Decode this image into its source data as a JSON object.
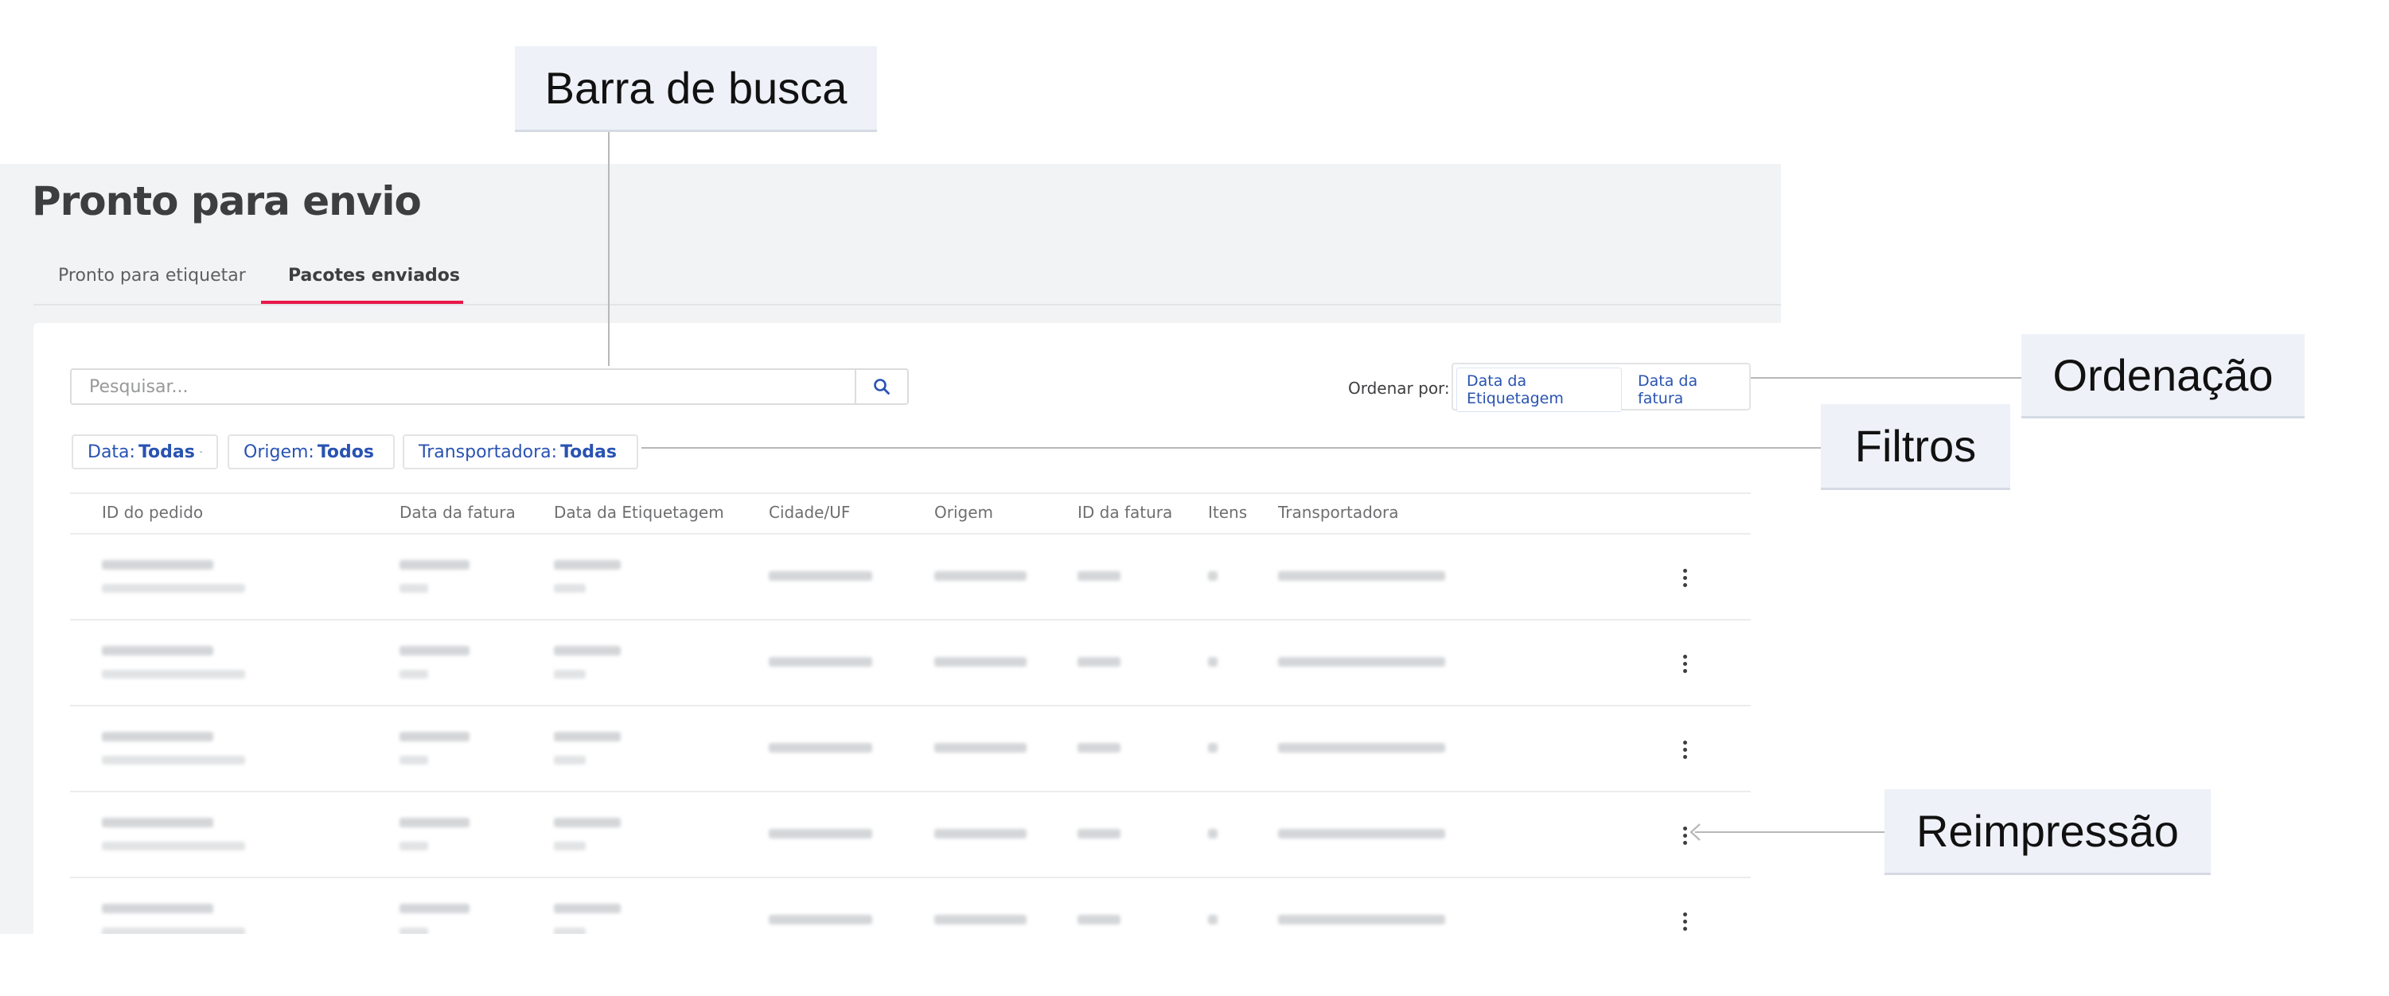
{
  "page": {
    "title": "Pronto para envio",
    "tabs": [
      "Pronto para etiquetar",
      "Pacotes enviados"
    ],
    "active_tab": "Pacotes enviados"
  },
  "search": {
    "placeholder": "Pesquisar..."
  },
  "sort": {
    "label": "Ordenar por:",
    "options": [
      "Data da Etiquetagem",
      "Data da fatura"
    ]
  },
  "filters": [
    {
      "label": "Data:",
      "value": "Todas"
    },
    {
      "label": "Origem:",
      "value": "Todos"
    },
    {
      "label": "Transportadora:",
      "value": "Todas"
    }
  ],
  "table": {
    "columns": [
      "ID do pedido",
      "Data da fatura",
      "Data da Etiquetagem",
      "Cidade/UF",
      "Origem",
      "ID da fatura",
      "Itens",
      "Transportadora"
    ],
    "row_count": 5,
    "row_action_icon": "kebab-menu-icon"
  },
  "annotations": {
    "search_bar": "Barra de busca",
    "sorting": "Ordenação",
    "filters": "Filtros",
    "reprint": "Reimpressão"
  },
  "colors": {
    "accent_blue": "#2953b2",
    "active_tab_underline": "#e8184a",
    "callout_bg": "#eef1f7"
  }
}
